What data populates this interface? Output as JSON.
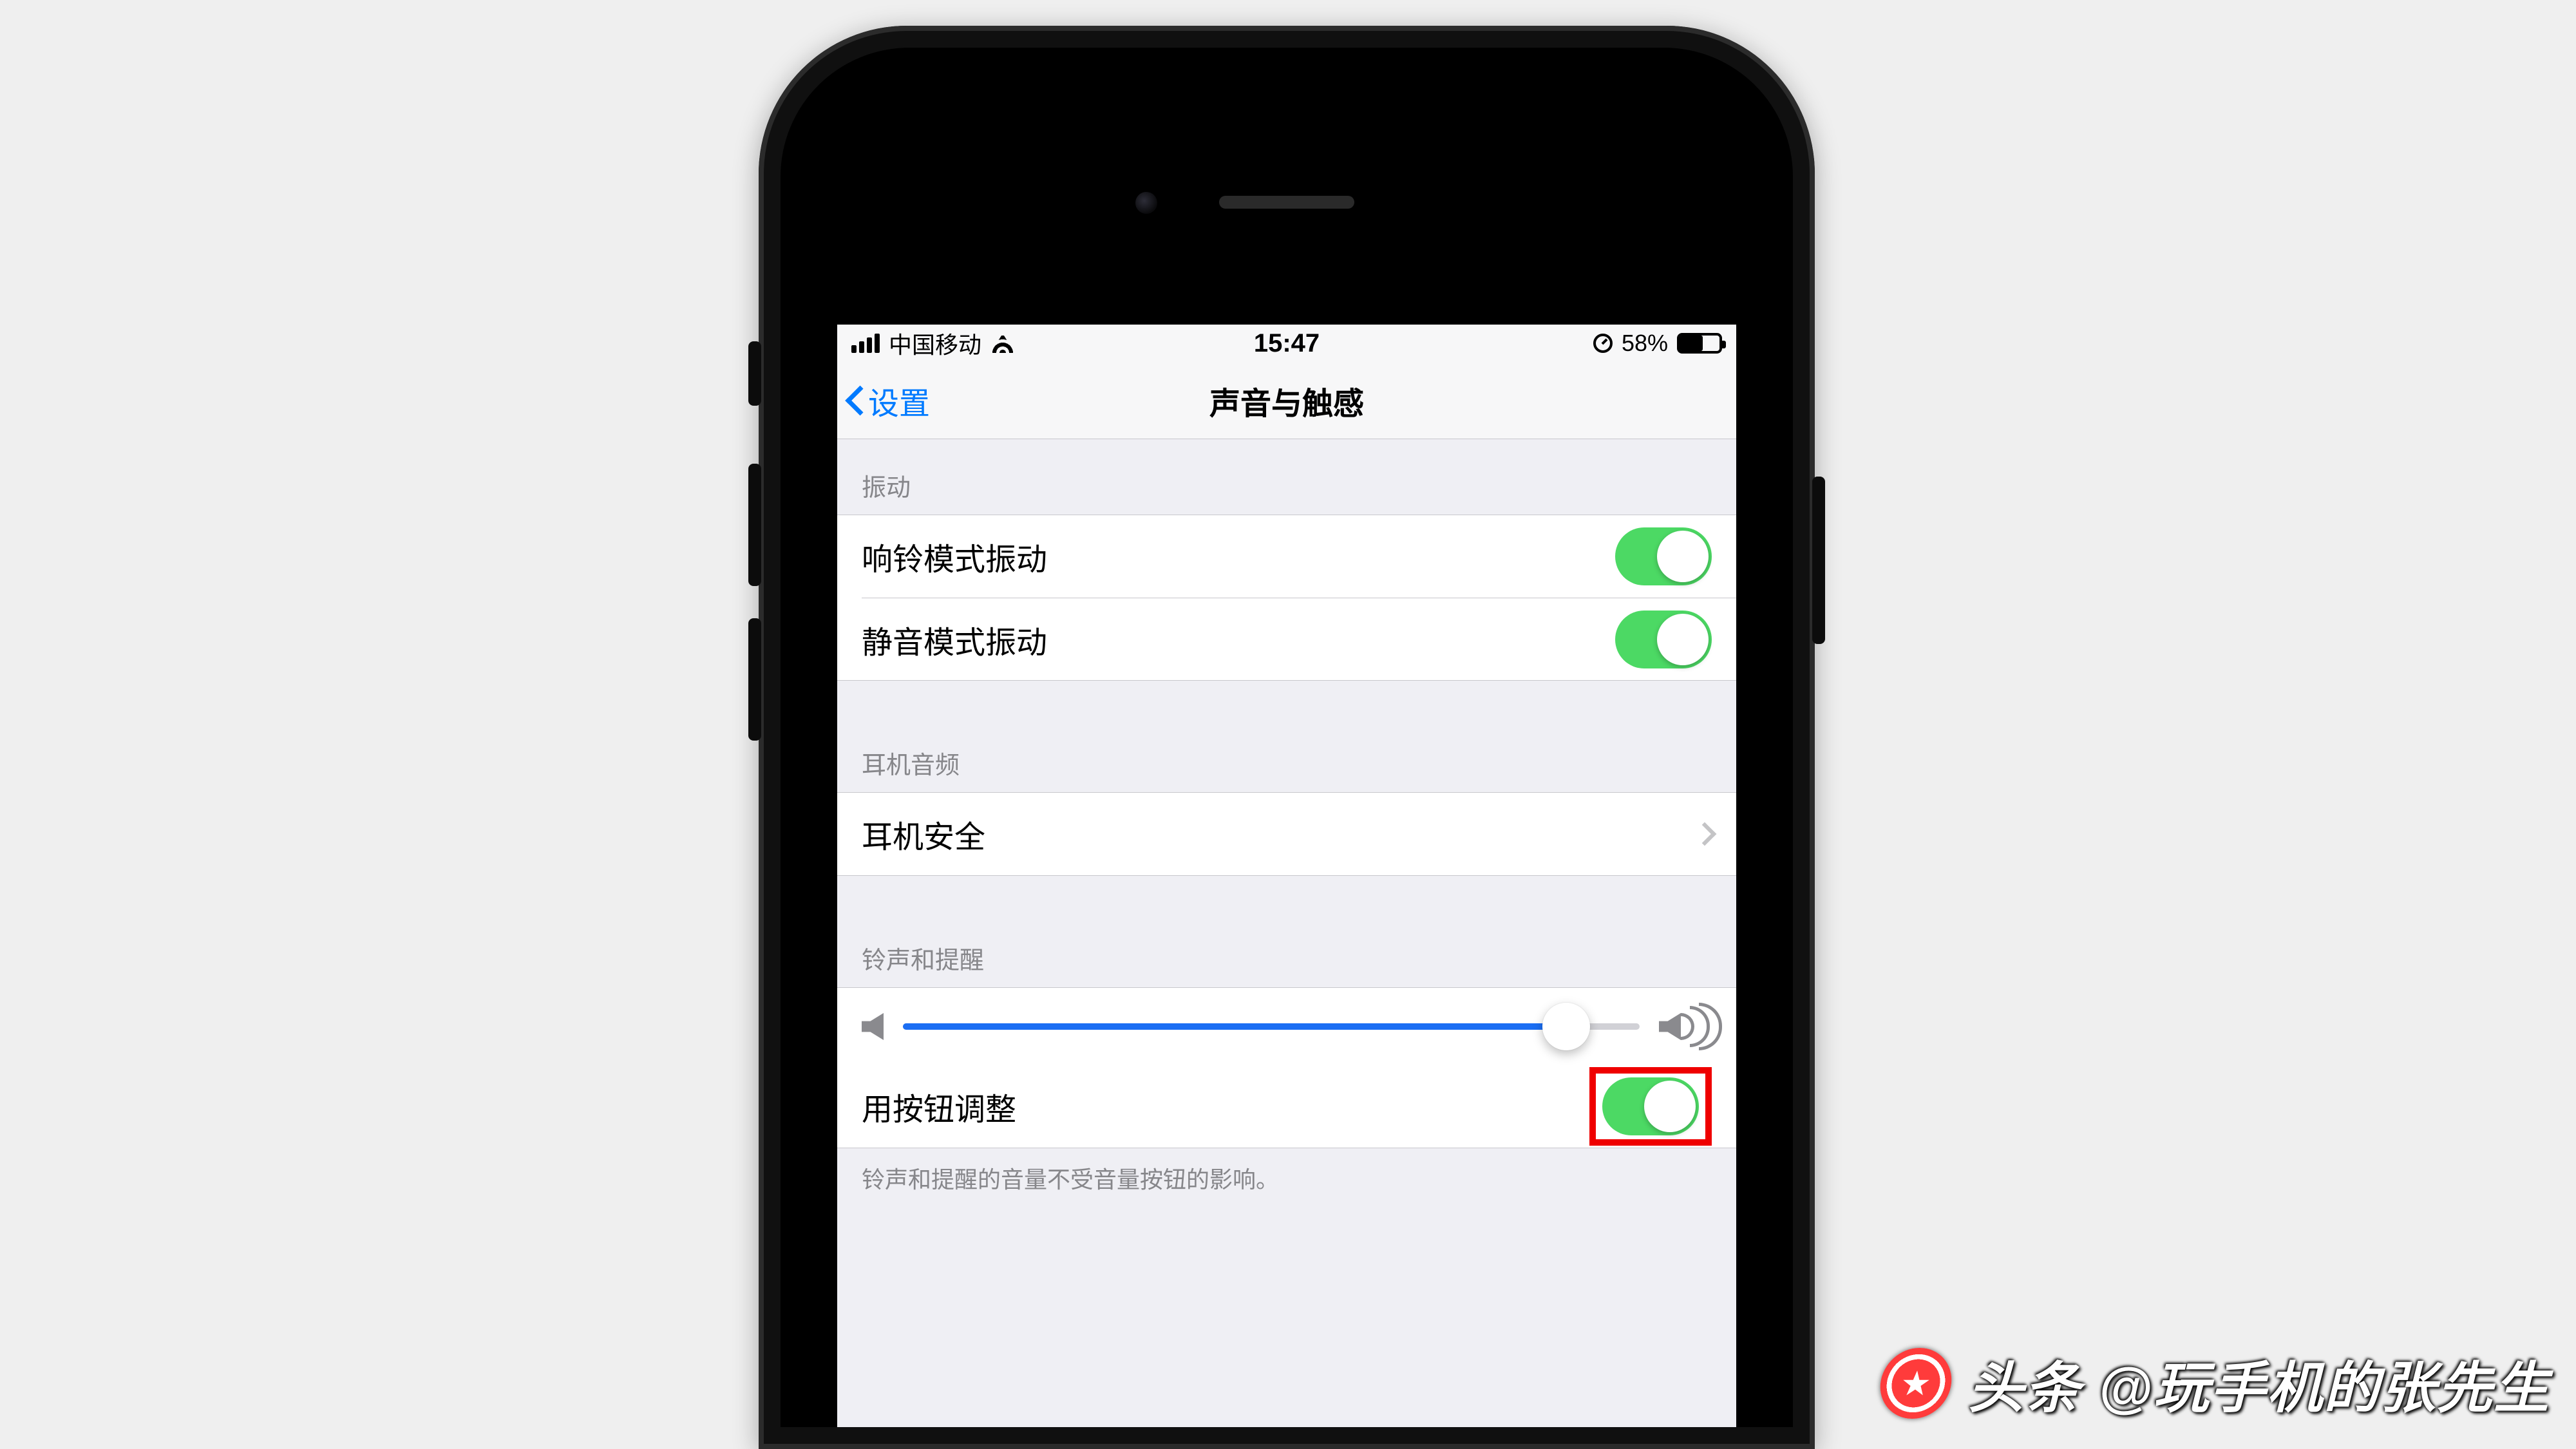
{
  "status": {
    "carrier": "中国移动",
    "time": "15:47",
    "battery_pct_text": "58%",
    "battery_pct": 58
  },
  "nav": {
    "back_label": "设置",
    "title": "声音与触感"
  },
  "sections": {
    "vibrate_header": "振动",
    "ring_vibrate": "响铃模式振动",
    "silent_vibrate": "静音模式振动",
    "headphone_header": "耳机音频",
    "headphone_safety": "耳机安全",
    "ringer_header": "铃声和提醒",
    "change_with_buttons": "用按钮调整",
    "footer": "铃声和提醒的音量不受音量按钮的影响。"
  },
  "slider": {
    "value_pct": 90
  },
  "toggles": {
    "ring_vibrate_on": true,
    "silent_vibrate_on": true,
    "change_with_buttons_on": true
  },
  "watermark": {
    "text": "头条 @玩手机的张先生"
  }
}
